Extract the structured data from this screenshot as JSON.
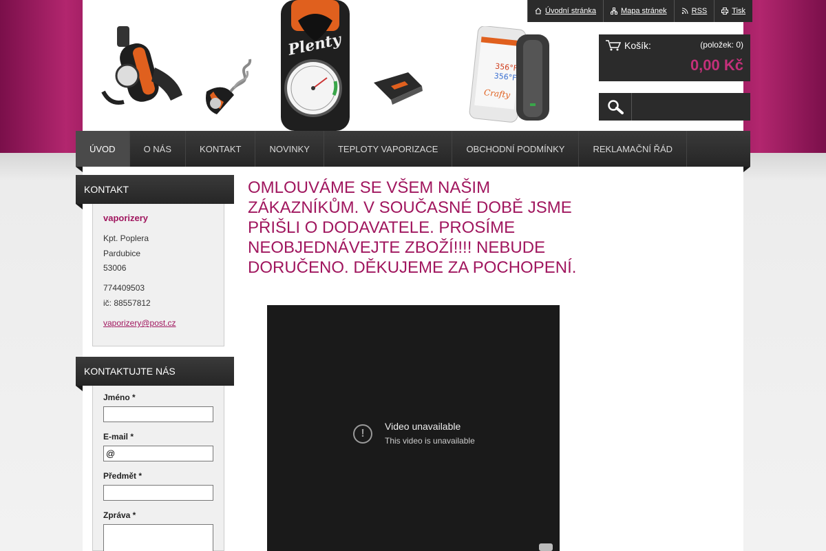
{
  "toplinks": [
    {
      "label": "Úvodní stránka",
      "icon": "home-icon"
    },
    {
      "label": "Mapa stránek",
      "icon": "sitemap-icon"
    },
    {
      "label": "RSS",
      "icon": "rss-icon"
    },
    {
      "label": "Tisk",
      "icon": "print-icon"
    }
  ],
  "cart": {
    "label": "Košík:",
    "count": "(položek: 0)",
    "price": "0,00 Kč"
  },
  "nav": [
    "ÚVOD",
    "O NÁS",
    "KONTAKT",
    "NOVINKY",
    "TEPLOTY VAPORIZACE",
    "OBCHODNÍ PODMÍNKY",
    "REKLAMAČNÍ ŘÁD"
  ],
  "sidebar": {
    "contact_title": "KONTAKT",
    "name": "vaporizery",
    "street": "Kpt. Poplera",
    "city": "Pardubice",
    "zip": "53006",
    "phone": "774409503",
    "ic": "ič: 88557812",
    "email": "vaporizery@post.cz",
    "form_title": "KONTAKTUJTE NÁS",
    "form": {
      "name_label": "Jméno *",
      "email_label": "E-mail *",
      "email_value": "@",
      "subject_label": "Předmět *",
      "message_label": "Zpráva *"
    }
  },
  "main": {
    "headline": "OMLOUVÁME SE VŠEM NAŠIM ZÁKAZNÍKŮM. V SOUČASNÉ DOBĚ JSME PŘIŠLI O DODAVATELE. PROSÍME NEOBJEDNÁVEJTE ZBOŽÍ!!!! NEBUDE DORUČENO. DĚKUJEME ZA POCHOPENÍ.",
    "video": {
      "title": "Video unavailable",
      "subtitle": "This video is unavailable"
    }
  },
  "colors": {
    "accent": "#a0165e",
    "dark": "#2b2b2b",
    "price": "#c4307a"
  }
}
